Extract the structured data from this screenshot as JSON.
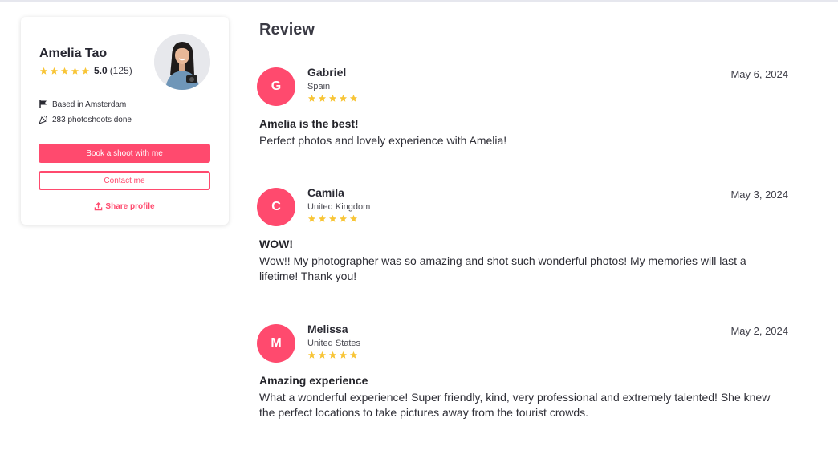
{
  "colors": {
    "accent": "#ff4a6e",
    "star": "#f8c537"
  },
  "profile": {
    "name": "Amelia Tao",
    "rating": "5.0",
    "count": "(125)",
    "stars": 5,
    "based": "Based in Amsterdam",
    "photoshoots": "283 photoshoots done",
    "book_label": "Book a shoot with me",
    "contact_label": "Contact me",
    "share_label": "Share profile"
  },
  "reviews_section": {
    "title": "Review",
    "items": [
      {
        "initial": "G",
        "name": "Gabriel",
        "country": "Spain",
        "stars": 5,
        "date": "May 6, 2024",
        "title": "Amelia is the best!",
        "body": "Perfect photos and lovely experience with Amelia!"
      },
      {
        "initial": "C",
        "name": "Camila",
        "country": "United Kingdom",
        "stars": 5,
        "date": "May 3, 2024",
        "title": "WOW!",
        "body": "Wow!! My photographer was so amazing and shot such wonderful photos! My memories will last a lifetime! Thank you!"
      },
      {
        "initial": "M",
        "name": "Melissa",
        "country": "United States",
        "stars": 5,
        "date": "May 2, 2024",
        "title": "Amazing experience",
        "body": "What a wonderful experience! Super friendly, kind, very professional and extremely talented! She knew the perfect locations to take pictures away from the tourist crowds."
      }
    ]
  }
}
